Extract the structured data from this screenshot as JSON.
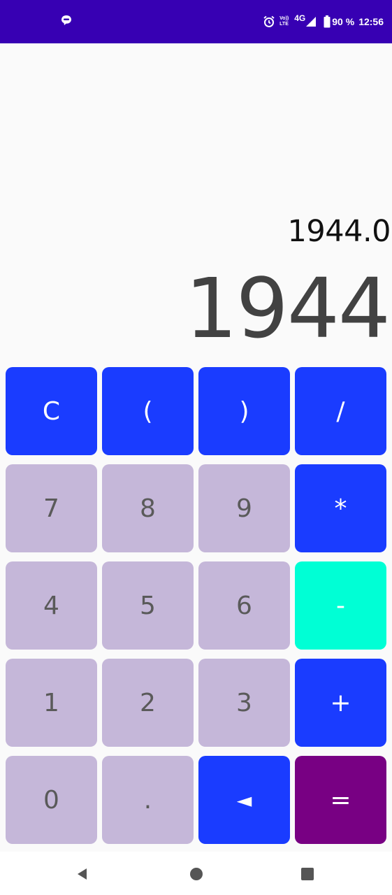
{
  "status_bar": {
    "battery_text": "90 %",
    "time": "12:56",
    "network_type": "4G",
    "volte_top": "Vo))",
    "volte_bottom": "LTE",
    "icons": [
      "chat-notification-icon",
      "alarm-icon",
      "volte-icon",
      "signal-icon",
      "battery-icon"
    ]
  },
  "display": {
    "result": "1944.0",
    "expression": "1944"
  },
  "keypad": {
    "rows": [
      [
        {
          "label": "C",
          "kind": "op"
        },
        {
          "label": "(",
          "kind": "op"
        },
        {
          "label": ")",
          "kind": "op"
        },
        {
          "label": "/",
          "kind": "op"
        }
      ],
      [
        {
          "label": "7",
          "kind": "num"
        },
        {
          "label": "8",
          "kind": "num"
        },
        {
          "label": "9",
          "kind": "num"
        },
        {
          "label": "*",
          "kind": "op"
        }
      ],
      [
        {
          "label": "4",
          "kind": "num"
        },
        {
          "label": "5",
          "kind": "num"
        },
        {
          "label": "6",
          "kind": "num"
        },
        {
          "label": "-",
          "kind": "minus"
        }
      ],
      [
        {
          "label": "1",
          "kind": "num"
        },
        {
          "label": "2",
          "kind": "num"
        },
        {
          "label": "3",
          "kind": "num"
        },
        {
          "label": "+",
          "kind": "op"
        }
      ],
      [
        {
          "label": "0",
          "kind": "num"
        },
        {
          "label": ".",
          "kind": "num"
        },
        {
          "label": "◄",
          "kind": "op"
        },
        {
          "label": "=",
          "kind": "eq"
        }
      ]
    ]
  },
  "colors": {
    "status_bar": "#3700b3",
    "operator_key": "#1a3cff",
    "number_key": "#c5b7d9",
    "minus_key": "#00ffd5",
    "equals_key": "#780083"
  },
  "nav_bar": {
    "icons": [
      "back-icon",
      "home-icon",
      "recents-icon"
    ]
  }
}
